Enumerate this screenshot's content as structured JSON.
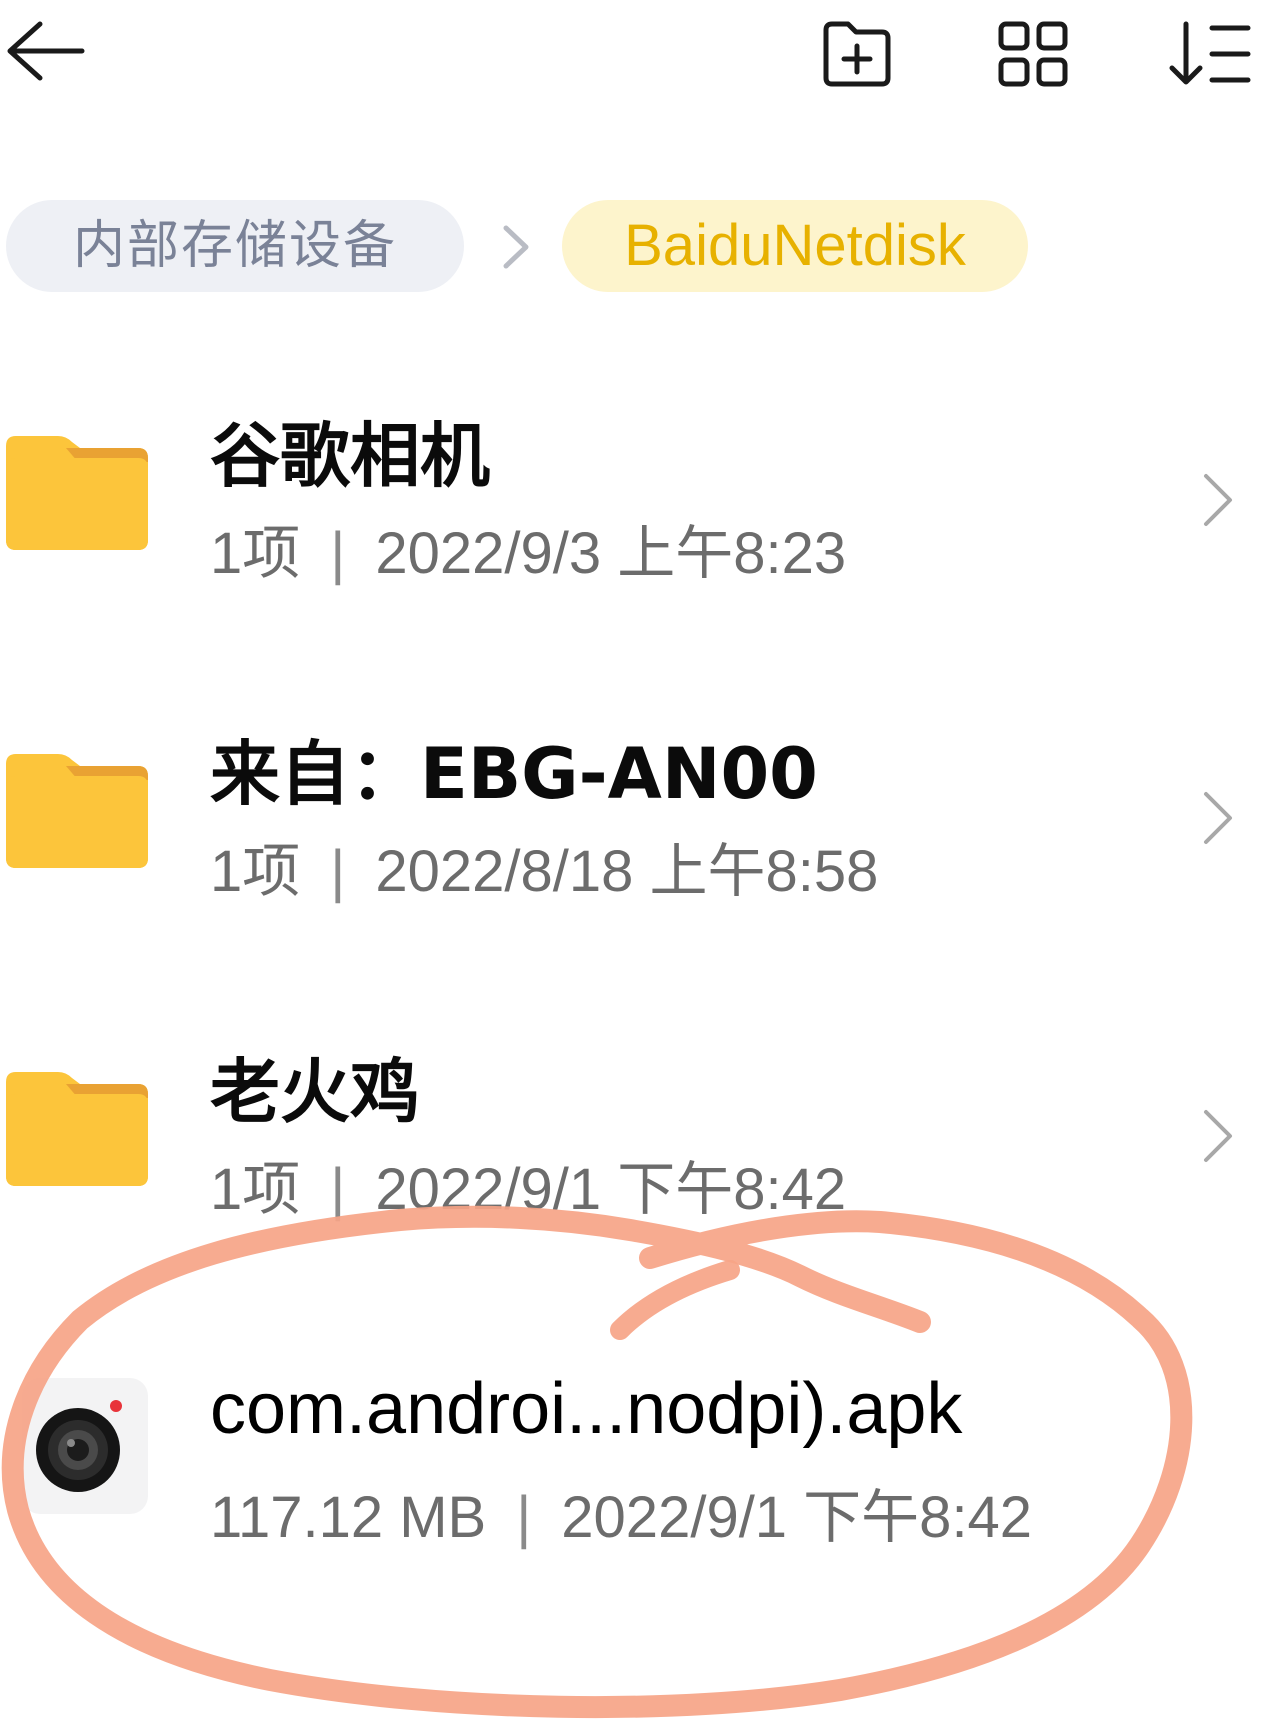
{
  "toolbar": {
    "back": "back-arrow-icon",
    "new_folder": "new-folder-icon",
    "view_toggle": "grid-view-icon",
    "sort": "sort-icon"
  },
  "breadcrumb": {
    "root": "内部存储设备",
    "current": "BaiduNetdisk",
    "separator_icon": "chevron-right-icon"
  },
  "items": [
    {
      "name": "谷歌相机",
      "count": "1项",
      "separator": "|",
      "date": "2022/9/3 上午8:23",
      "icon": "folder-icon"
    },
    {
      "name": "来自：EBG-AN00",
      "count": "1项",
      "separator": "|",
      "date": "2022/8/18 上午8:58",
      "icon": "folder-icon"
    },
    {
      "name": "老火鸡",
      "count": "1项",
      "separator": "|",
      "date": "2022/9/1 下午8:42",
      "icon": "folder-icon"
    },
    {
      "name": "com.androi...nodpi).apk",
      "size": "117.12 MB",
      "separator": "|",
      "date": "2022/9/1 下午8:42",
      "icon": "camera-app-icon"
    }
  ],
  "colors": {
    "folder": "#fcc53b",
    "folder_tab": "#e9a233",
    "breadcrumb_root_bg": "#eef0f5",
    "breadcrumb_current_bg": "#fdf4cc",
    "breadcrumb_current_text": "#e7b100",
    "annotation": "#f6a487"
  }
}
